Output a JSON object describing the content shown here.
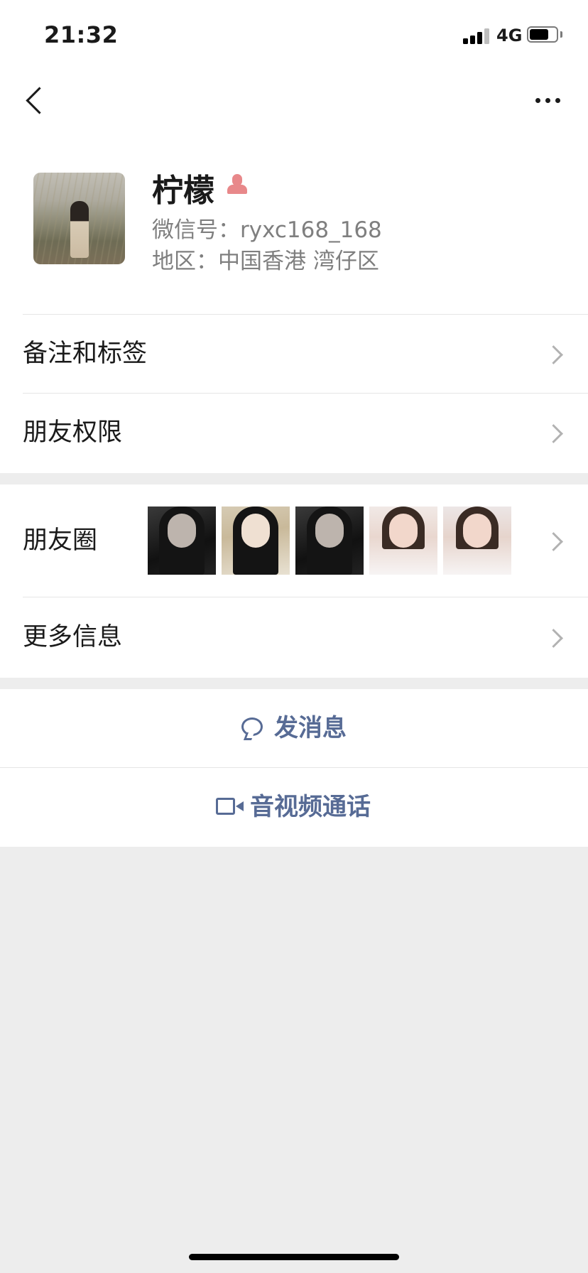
{
  "status_bar": {
    "time": "21:32",
    "network": "4G"
  },
  "nav": {
    "back_icon": "chevron-left-icon",
    "more_icon": "more-horizontal-icon"
  },
  "profile": {
    "name": "柠檬",
    "gender_icon": "female-icon",
    "gender_color": "#e8888a",
    "wechat_id_line": "微信号：ryxc168_168",
    "region_line": "地区：中国香港 湾仔区"
  },
  "rows": {
    "remark_tags": "备注和标签",
    "friend_permissions": "朋友权限",
    "moments": "朋友圈",
    "more_info": "更多信息"
  },
  "actions": {
    "send_message": "发消息",
    "video_call": "音视频通话"
  },
  "colors": {
    "link_blue": "#576b95",
    "background": "#ededed"
  }
}
